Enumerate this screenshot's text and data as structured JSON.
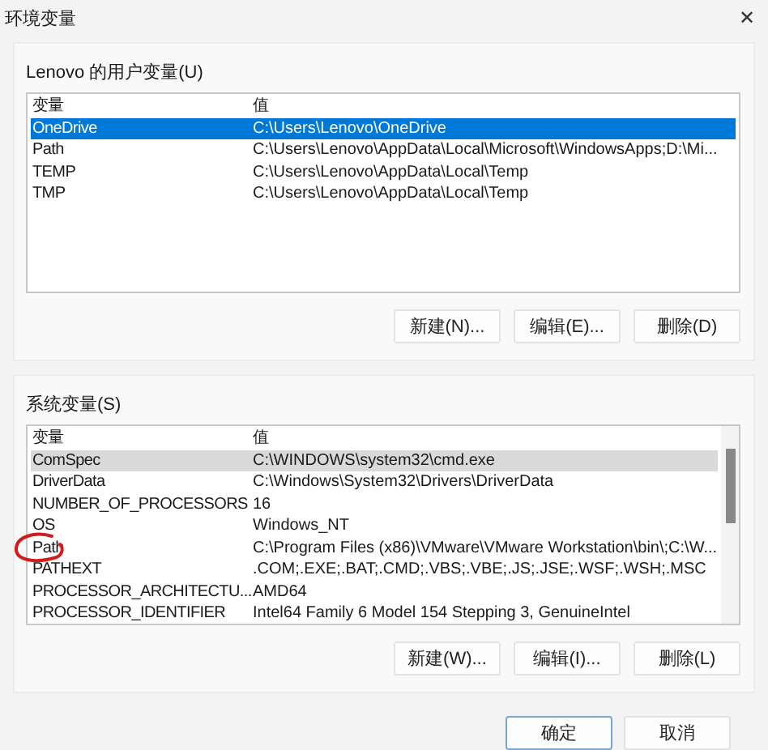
{
  "window": {
    "title": "环境变量",
    "close": "✕"
  },
  "user_vars": {
    "label": "Lenovo 的用户变量(U)",
    "focused": true,
    "columns": [
      "变量",
      "值"
    ],
    "rows": [
      {
        "name": "OneDrive",
        "value": "C:\\Users\\Lenovo\\OneDrive",
        "selected": true,
        "circled": false
      },
      {
        "name": "Path",
        "value": "C:\\Users\\Lenovo\\AppData\\Local\\Microsoft\\WindowsApps;D:\\Mi...",
        "selected": false,
        "circled": false
      },
      {
        "name": "TEMP",
        "value": "C:\\Users\\Lenovo\\AppData\\Local\\Temp",
        "selected": false,
        "circled": false
      },
      {
        "name": "TMP",
        "value": "C:\\Users\\Lenovo\\AppData\\Local\\Temp",
        "selected": false,
        "circled": false
      }
    ],
    "buttons": [
      "新建(N)...",
      "编辑(E)...",
      "删除(D)"
    ]
  },
  "system_vars": {
    "label": "系统变量(S)",
    "focused": false,
    "scrollbar": true,
    "columns": [
      "变量",
      "值"
    ],
    "rows": [
      {
        "name": "ComSpec",
        "value": "C:\\WINDOWS\\system32\\cmd.exe",
        "selected": true,
        "circled": false
      },
      {
        "name": "DriverData",
        "value": "C:\\Windows\\System32\\Drivers\\DriverData",
        "selected": false,
        "circled": false
      },
      {
        "name": "NUMBER_OF_PROCESSORS",
        "value": "16",
        "selected": false,
        "circled": false
      },
      {
        "name": "OS",
        "value": "Windows_NT",
        "selected": false,
        "circled": false
      },
      {
        "name": "Path",
        "value": "C:\\Program Files (x86)\\VMware\\VMware Workstation\\bin\\;C:\\W...",
        "selected": false,
        "circled": true
      },
      {
        "name": "PATHEXT",
        "value": ".COM;.EXE;.BAT;.CMD;.VBS;.VBE;.JS;.JSE;.WSF;.WSH;.MSC",
        "selected": false,
        "circled": false
      },
      {
        "name": "PROCESSOR_ARCHITECTU...",
        "value": "AMD64",
        "selected": false,
        "circled": false
      },
      {
        "name": "PROCESSOR_IDENTIFIER",
        "value": "Intel64 Family 6 Model 154 Stepping 3, GenuineIntel",
        "selected": false,
        "circled": false
      }
    ],
    "buttons": [
      "新建(W)...",
      "编辑(I)...",
      "删除(L)"
    ]
  },
  "footer_buttons": [
    {
      "label": "确定",
      "default": true
    },
    {
      "label": "取消",
      "default": false
    }
  ]
}
